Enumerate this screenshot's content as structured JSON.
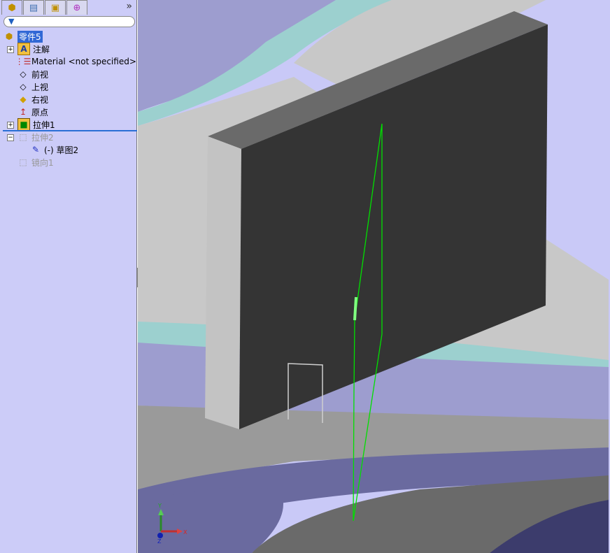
{
  "tabs": [
    {
      "icon": "feature-manager-icon"
    },
    {
      "icon": "property-manager-icon"
    },
    {
      "icon": "configuration-manager-icon"
    },
    {
      "icon": "dimxpert-icon"
    }
  ],
  "more_label": "»",
  "tree": {
    "root": "零件5",
    "items": [
      {
        "label": "注解",
        "icon": "annotations-folder-icon",
        "expand": "+"
      },
      {
        "label": "Material <not specified>",
        "icon": "material-icon"
      },
      {
        "label": "前视",
        "icon": "plane-icon"
      },
      {
        "label": "上视",
        "icon": "plane-icon"
      },
      {
        "label": "右视",
        "icon": "plane-icon"
      },
      {
        "label": "原点",
        "icon": "origin-icon"
      },
      {
        "label": "拉伸1",
        "icon": "extrude-icon",
        "expand": "+"
      },
      {
        "label": "拉伸2",
        "icon": "extrude-icon",
        "expand": "−",
        "suppressed": true
      },
      {
        "label": "(-) 草图2",
        "icon": "sketch-icon"
      },
      {
        "label": "镜向1",
        "icon": "mirror-icon",
        "suppressed": true
      }
    ]
  },
  "triad": {
    "x": "X",
    "y": "Y",
    "z": "Z"
  },
  "colors": {
    "panel": "#ccccf8",
    "selection": "#3168d5",
    "sketch": "#00e000",
    "rollback_bar": "#2a6fd6"
  }
}
